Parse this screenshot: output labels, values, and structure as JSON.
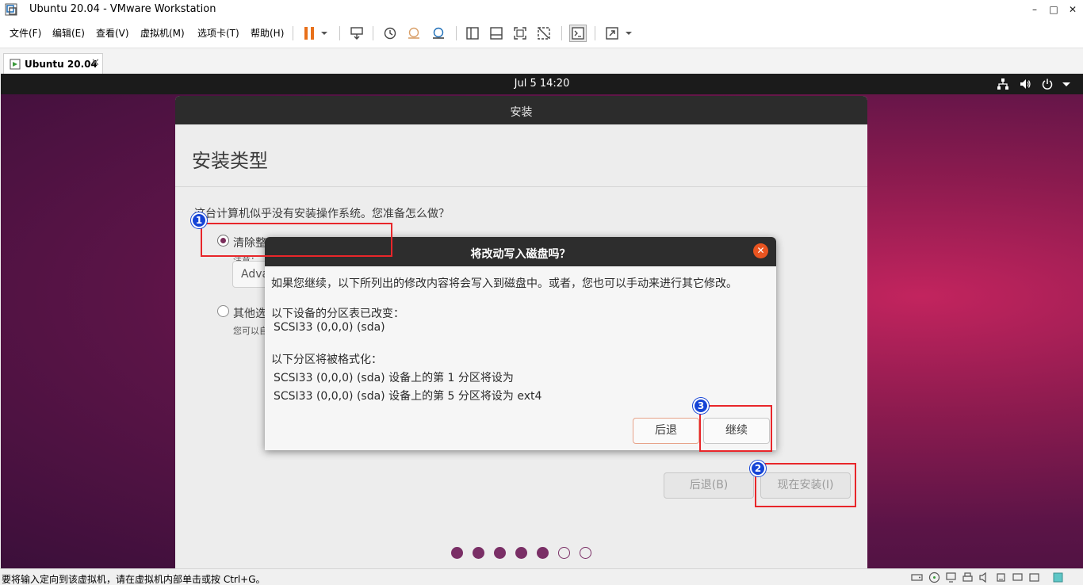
{
  "window": {
    "title": "Ubuntu 20.04 - VMware Workstation",
    "minimize": "–",
    "maximize": "□",
    "close": "✕"
  },
  "menu": {
    "items": [
      "文件(F)",
      "编辑(E)",
      "查看(V)",
      "虚拟机(M)",
      "选项卡(T)",
      "帮助(H)"
    ]
  },
  "tabs": [
    {
      "label": "Ubuntu 20.04",
      "close": "✕"
    }
  ],
  "guest": {
    "clock": "Jul 5  14:20"
  },
  "installer": {
    "window_title": "安装",
    "page_heading": "安装类型",
    "question": "这台计算机似乎没有安装操作系统。您准备怎么做？",
    "option1_label": "清除整",
    "option1_note": "注意：",
    "advanced_button": "Adva",
    "option2_label": "其他选",
    "option2_note": "您可以自",
    "back_button": "后退(B)",
    "install_button": "现在安装(I)",
    "progress": {
      "total_steps": 7,
      "completed_steps": 5
    }
  },
  "dialog": {
    "title": "将改动写入磁盘吗？",
    "close": "✕",
    "intro": "如果您继续，以下所列出的修改内容将会写入到磁盘中。或者，您也可以手动来进行其它修改。",
    "partition_table_heading": "以下设备的分区表已改变：",
    "partition_table_device": "SCSI33 (0,0,0) (sda)",
    "format_heading": "以下分区将被格式化：",
    "format_line1": "SCSI33 (0,0,0) (sda) 设备上的第 1 分区将设为",
    "format_line2": "SCSI33 (0,0,0) (sda) 设备上的第 5 分区将设为 ext4",
    "back_button": "后退",
    "continue_button": "继续"
  },
  "annotations": [
    "1",
    "2",
    "3"
  ],
  "statusbar": {
    "text": "要将输入定向到该虚拟机，请在虚拟机内部单击或按 Ctrl+G。"
  },
  "colors": {
    "ubuntu_orange": "#e95420",
    "aubergine": "#7a2f66",
    "annotation_red": "#e8262a",
    "annotation_blue": "#1544d6"
  }
}
